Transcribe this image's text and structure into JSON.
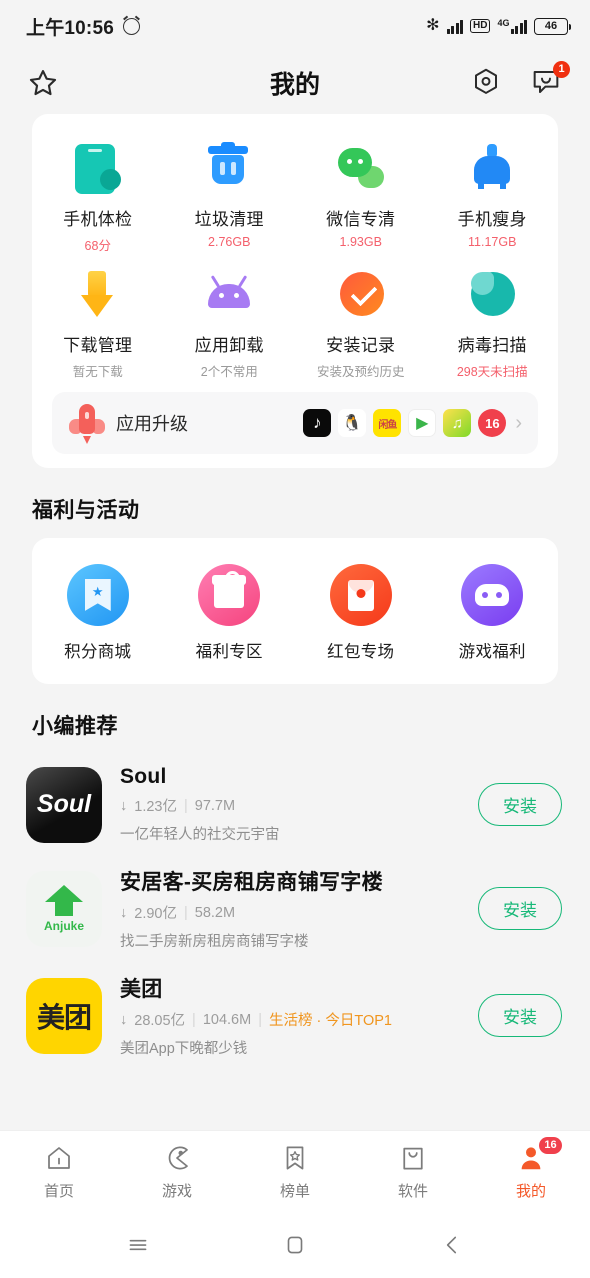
{
  "status_bar": {
    "time": "上午10:56",
    "alarm_icon": "alarm-icon",
    "bluetooth": "✻",
    "hd": "HD",
    "network": "4G",
    "battery": "46"
  },
  "header": {
    "star_icon": "star-icon",
    "title": "我的",
    "settings_icon": "hexagon-settings-icon",
    "message_icon": "chat-bubble-icon",
    "message_badge": "1"
  },
  "tools": [
    {
      "name": "手机体检",
      "sub": "68分",
      "sub_color": "red",
      "icon": "phone-checkup-icon"
    },
    {
      "name": "垃圾清理",
      "sub": "2.76GB",
      "sub_color": "red",
      "icon": "trash-clean-icon"
    },
    {
      "name": "微信专清",
      "sub": "1.93GB",
      "sub_color": "red",
      "icon": "wechat-clean-icon"
    },
    {
      "name": "手机瘦身",
      "sub": "11.17GB",
      "sub_color": "red",
      "icon": "phone-slim-icon"
    },
    {
      "name": "下载管理",
      "sub": "暂无下载",
      "sub_color": "gray",
      "icon": "download-arrow-icon"
    },
    {
      "name": "应用卸载",
      "sub": "2个不常用",
      "sub_color": "gray",
      "icon": "android-uninstall-icon"
    },
    {
      "name": "安装记录",
      "sub": "安装及预约历史",
      "sub_color": "gray",
      "icon": "install-record-icon"
    },
    {
      "name": "病毒扫描",
      "sub": "298天未扫描",
      "sub_color": "red",
      "icon": "virus-scan-icon"
    }
  ],
  "upgrade": {
    "rocket_icon": "rocket-icon",
    "label": "应用升级",
    "apps": [
      {
        "name": "抖音",
        "glyph": "♪"
      },
      {
        "name": "QQ",
        "glyph": "🐧"
      },
      {
        "name": "闲鱼",
        "glyph": "闲鱼"
      },
      {
        "name": "腾讯视频",
        "glyph": "▶"
      },
      {
        "name": "酷狗音乐",
        "glyph": "♫"
      }
    ],
    "count_badge": "16",
    "chevron": "›"
  },
  "benefits_section": {
    "title": "福利与活动",
    "items": [
      {
        "label": "积分商城",
        "icon": "points-mall-icon"
      },
      {
        "label": "福利专区",
        "icon": "gift-zone-icon"
      },
      {
        "label": "红包专场",
        "icon": "red-packet-icon"
      },
      {
        "label": "游戏福利",
        "icon": "game-benefit-icon"
      }
    ]
  },
  "recommend_section": {
    "title": "小编推荐",
    "install_label": "安装",
    "download_icon": "↓",
    "apps": [
      {
        "name": "Soul",
        "icon_text": "Soul",
        "downloads": "1.23亿",
        "size": "97.7M",
        "tag": "",
        "desc": "一亿年轻人的社交元宇宙"
      },
      {
        "name": "安居客-买房租房商铺写字楼",
        "icon_text": "Anjuke",
        "downloads": "2.90亿",
        "size": "58.2M",
        "tag": "",
        "desc": "找二手房新房租房商铺写字楼"
      },
      {
        "name": "美团",
        "icon_text": "美团",
        "downloads": "28.05亿",
        "size": "104.6M",
        "tag": "生活榜 · 今日TOP1",
        "desc": "美团App下晚都少钱"
      }
    ]
  },
  "tabbar": {
    "items": [
      {
        "label": "首页",
        "icon": "home-icon",
        "active": false
      },
      {
        "label": "游戏",
        "icon": "game-pacman-icon",
        "active": false
      },
      {
        "label": "榜单",
        "icon": "ranking-bookmark-icon",
        "active": false
      },
      {
        "label": "软件",
        "icon": "software-bag-icon",
        "active": false
      },
      {
        "label": "我的",
        "icon": "profile-person-icon",
        "active": true,
        "badge": "16"
      }
    ]
  },
  "system_nav": {
    "recents_icon": "recents-icon",
    "home_icon": "home-square-icon",
    "back_icon": "back-chevron-icon"
  }
}
